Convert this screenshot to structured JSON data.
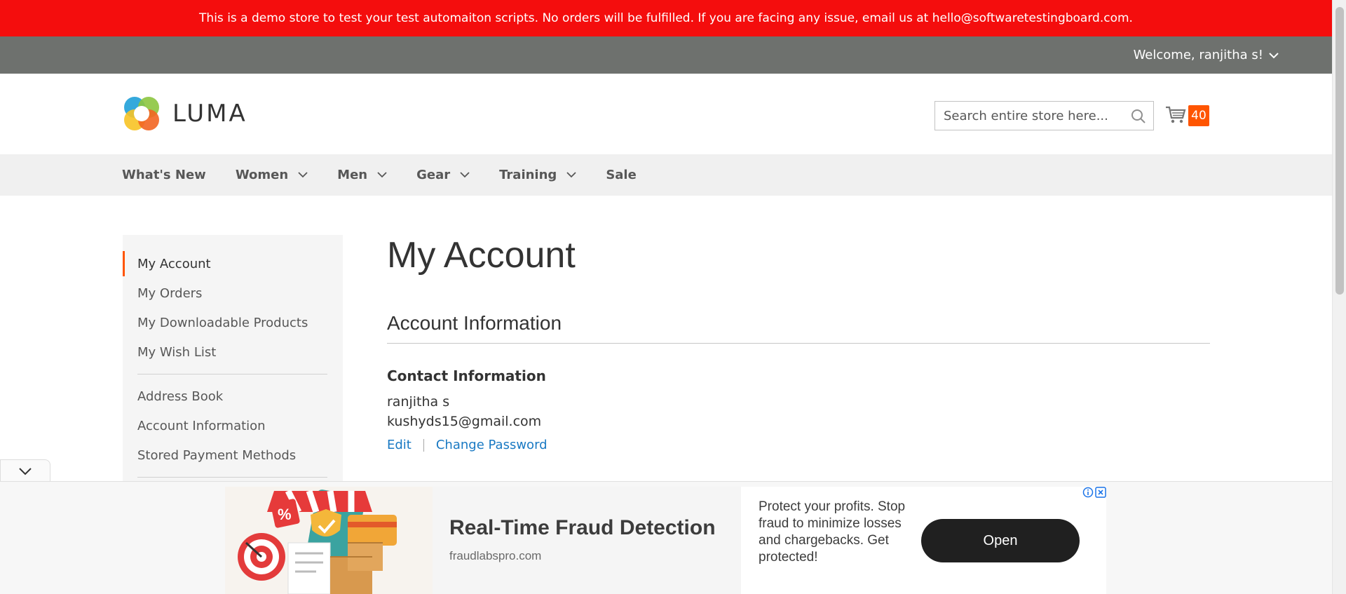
{
  "demo_banner": {
    "text": "This is a demo store to test your test automaiton scripts. No orders will be fulfilled. If you are facing any issue, email us at hello@softwaretestingboard.com."
  },
  "top_bar": {
    "welcome": "Welcome, ranjitha s!"
  },
  "header": {
    "logo_text": "LUMA",
    "search_placeholder": "Search entire store here...",
    "cart_count": "40"
  },
  "nav": {
    "items": [
      {
        "label": "What's New",
        "dropdown": false
      },
      {
        "label": "Women",
        "dropdown": true
      },
      {
        "label": "Men",
        "dropdown": true
      },
      {
        "label": "Gear",
        "dropdown": true
      },
      {
        "label": "Training",
        "dropdown": true
      },
      {
        "label": "Sale",
        "dropdown": false
      }
    ]
  },
  "sidebar": {
    "items": [
      {
        "label": "My Account",
        "active": true
      },
      {
        "label": "My Orders"
      },
      {
        "label": "My Downloadable Products"
      },
      {
        "label": "My Wish List"
      },
      {
        "label": "Address Book"
      },
      {
        "label": "Account Information"
      },
      {
        "label": "Stored Payment Methods"
      }
    ]
  },
  "main": {
    "title": "My Account",
    "section_title": "Account Information",
    "contact": {
      "title": "Contact Information",
      "name": "ranjitha s",
      "email": "kushyds15@gmail.com",
      "edit_label": "Edit",
      "change_password_label": "Change Password"
    }
  },
  "ad": {
    "headline": "Real-Time Fraud Detection",
    "domain": "fraudlabspro.com",
    "description": "Protect your profits. Stop fraud to minimize losses and chargebacks. Get protected!",
    "cta": "Open"
  },
  "colors": {
    "demo_banner": "#f40d0d",
    "top_bar": "#6e716e",
    "accent": "#ff5501",
    "link": "#1979c3"
  }
}
